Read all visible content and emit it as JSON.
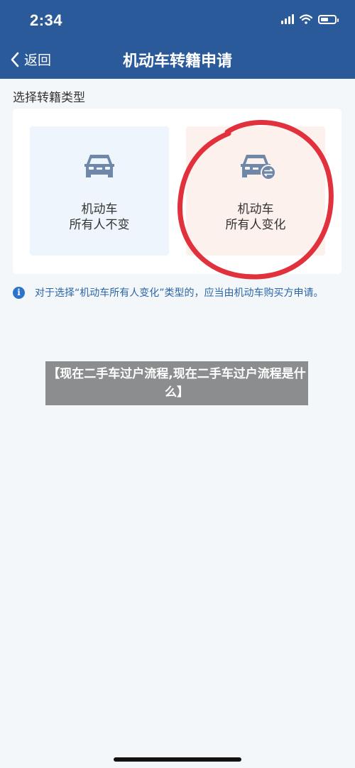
{
  "status_bar": {
    "time": "2:34"
  },
  "nav": {
    "back_label": "返回",
    "title": "机动车转籍申请"
  },
  "section": {
    "label": "选择转籍类型"
  },
  "options": [
    {
      "line1": "机动车",
      "line2": "所有人不变"
    },
    {
      "line1": "机动车",
      "line2": "所有人变化"
    }
  ],
  "info": {
    "icon": "i",
    "text": "对于选择“机动车所有人变化”类型的，应当由机动车购买方申请。"
  },
  "overlay": {
    "text": "【现在二手车过户流程,现在二手车过户流程是什么】"
  },
  "colors": {
    "header": "#2b5a9a",
    "accent_red": "#e0313c",
    "info_blue": "#2b74c8"
  }
}
